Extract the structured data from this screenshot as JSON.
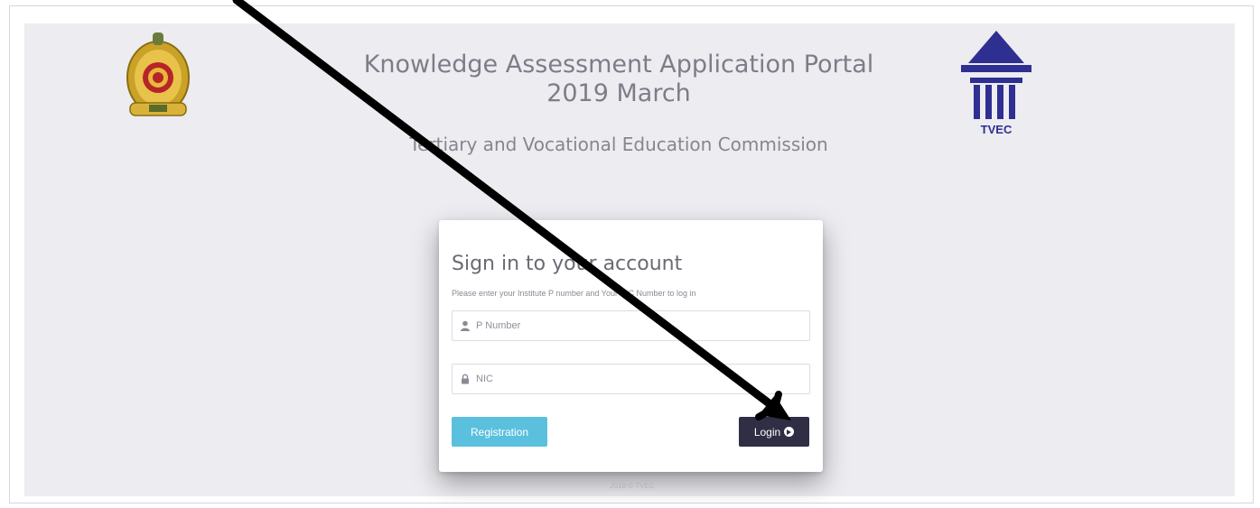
{
  "header": {
    "title_line1": "Knowledge Assessment Application Portal",
    "title_line2": "2019 March",
    "subtitle": "Tertiary and Vocational Education Commission",
    "tvec_logo_text": "TVEC"
  },
  "login": {
    "heading": "Sign in to your account",
    "instructions": "Please enter your Institute P number and Your NIC Number to log in",
    "p_number_placeholder": "P Number",
    "nic_placeholder": "NIC",
    "registration_label": "Registration",
    "login_label": "Login"
  },
  "footer": {
    "text": "2018 © TVEC"
  },
  "icons": {
    "p_number": "user-icon",
    "nic": "lock-icon",
    "login": "circle-arrow-right-icon"
  },
  "colors": {
    "registration_button": "#5bc0de",
    "login_button": "#2f2e45",
    "tvec_blue": "#2f2f92",
    "background": "#ececf1"
  }
}
